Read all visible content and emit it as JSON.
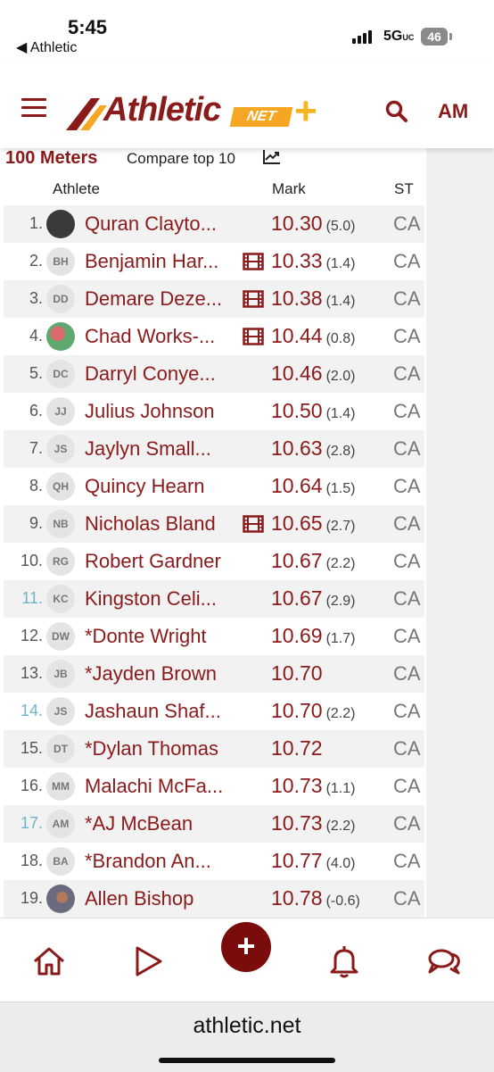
{
  "status": {
    "time": "5:45",
    "back_app": "Athletic",
    "network": "5G",
    "network_suffix": "UC",
    "battery": "46"
  },
  "header": {
    "logo_text": "Athletic",
    "logo_net": "NET",
    "logo_plus": "+",
    "user_initials": "AM"
  },
  "section": {
    "event": "100 Meters",
    "compare_label": "Compare top 10"
  },
  "table": {
    "headers": {
      "athlete": "Athlete",
      "mark": "Mark",
      "st": "ST"
    },
    "rows": [
      {
        "rank": "1.",
        "initials": "",
        "name": "Quran Clayto...",
        "mark": "10.30",
        "wind": "(5.0)",
        "st": "CA",
        "video": false
      },
      {
        "rank": "2.",
        "initials": "BH",
        "name": "Benjamin Har...",
        "mark": "10.33",
        "wind": "(1.4)",
        "st": "CA",
        "video": true
      },
      {
        "rank": "3.",
        "initials": "DD",
        "name": "Demare Deze...",
        "mark": "10.38",
        "wind": "(1.4)",
        "st": "CA",
        "video": true
      },
      {
        "rank": "4.",
        "initials": "",
        "name": "Chad Works-...",
        "mark": "10.44",
        "wind": "(0.8)",
        "st": "CA",
        "video": true
      },
      {
        "rank": "5.",
        "initials": "DC",
        "name": "Darryl Conye...",
        "mark": "10.46",
        "wind": "(2.0)",
        "st": "CA",
        "video": false
      },
      {
        "rank": "6.",
        "initials": "JJ",
        "name": "Julius Johnson",
        "mark": "10.50",
        "wind": "(1.4)",
        "st": "CA",
        "video": false
      },
      {
        "rank": "7.",
        "initials": "JS",
        "name": "Jaylyn Small...",
        "mark": "10.63",
        "wind": "(2.8)",
        "st": "CA",
        "video": false
      },
      {
        "rank": "8.",
        "initials": "QH",
        "name": "Quincy Hearn",
        "mark": "10.64",
        "wind": "(1.5)",
        "st": "CA",
        "video": false
      },
      {
        "rank": "9.",
        "initials": "NB",
        "name": "Nicholas Bland",
        "mark": "10.65",
        "wind": "(2.7)",
        "st": "CA",
        "video": true
      },
      {
        "rank": "10.",
        "initials": "RG",
        "name": "Robert Gardner",
        "mark": "10.67",
        "wind": "(2.2)",
        "st": "CA",
        "video": false
      },
      {
        "rank": "11.",
        "initials": "KC",
        "name": "Kingston Celi...",
        "mark": "10.67",
        "wind": "(2.9)",
        "st": "CA",
        "video": false
      },
      {
        "rank": "12.",
        "initials": "DW",
        "name": "*Donte Wright",
        "mark": "10.69",
        "wind": "(1.7)",
        "st": "CA",
        "video": false
      },
      {
        "rank": "13.",
        "initials": "JB",
        "name": "*Jayden Brown",
        "mark": "10.70",
        "wind": "",
        "st": "CA",
        "video": false
      },
      {
        "rank": "14.",
        "initials": "JS",
        "name": "Jashaun Shaf...",
        "mark": "10.70",
        "wind": "(2.2)",
        "st": "CA",
        "video": false
      },
      {
        "rank": "15.",
        "initials": "DT",
        "name": "*Dylan Thomas",
        "mark": "10.72",
        "wind": "",
        "st": "CA",
        "video": false
      },
      {
        "rank": "16.",
        "initials": "MM",
        "name": "Malachi McFa...",
        "mark": "10.73",
        "wind": "(1.1)",
        "st": "CA",
        "video": false
      },
      {
        "rank": "17.",
        "initials": "AM",
        "name": "*AJ McBean",
        "mark": "10.73",
        "wind": "(2.2)",
        "st": "CA",
        "video": false
      },
      {
        "rank": "18.",
        "initials": "BA",
        "name": "*Brandon An...",
        "mark": "10.77",
        "wind": "(4.0)",
        "st": "CA",
        "video": false
      },
      {
        "rank": "19.",
        "initials": "",
        "name": "Allen Bishop",
        "mark": "10.78",
        "wind": "(-0.6)",
        "st": "CA",
        "video": false
      }
    ]
  },
  "bottom_nav": {
    "plus_label": "+",
    "icons": [
      "home-icon",
      "play-icon",
      "bell-icon",
      "chat-icon"
    ]
  },
  "browser": {
    "url": "athletic.net"
  },
  "colors": {
    "brand": "#8b1a1a",
    "accent": "#f5a623",
    "tie_rank": "#6fb3c9"
  }
}
